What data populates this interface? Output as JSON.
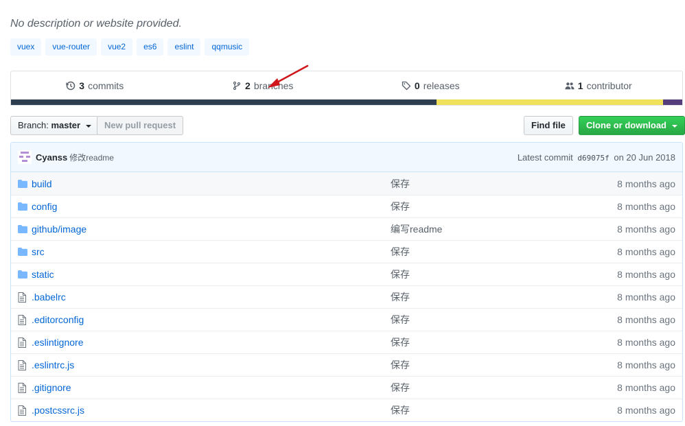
{
  "repo": {
    "description": "No description or website provided.",
    "topics": [
      "vuex",
      "vue-router",
      "vue2",
      "es6",
      "eslint",
      "qqmusic"
    ]
  },
  "summary": {
    "commits": {
      "count": "3",
      "label": "commits"
    },
    "branches": {
      "count": "2",
      "label": "branches"
    },
    "releases": {
      "count": "0",
      "label": "releases"
    },
    "contributors": {
      "count": "1",
      "label": "contributor"
    }
  },
  "language_bar": [
    {
      "color": "#2c3e50",
      "fraction": 0.634
    },
    {
      "color": "#f1e05a",
      "fraction": 0.337
    },
    {
      "color": "#563d7c",
      "fraction": 0.029
    }
  ],
  "toolbar": {
    "branch_prefix": "Branch:",
    "branch_name": "master",
    "new_pr_label": "New pull request",
    "find_file_label": "Find file",
    "clone_label": "Clone or download"
  },
  "latest_commit": {
    "author": "Cyanss",
    "message": "修改readme",
    "prefix": "Latest commit",
    "sha": "d69075f",
    "date": "on 20 Jun 2018"
  },
  "files": [
    {
      "type": "dir",
      "name": "build",
      "message": "保存",
      "age": "8 months ago"
    },
    {
      "type": "dir",
      "name": "config",
      "message": "保存",
      "age": "8 months ago"
    },
    {
      "type": "dir",
      "name": "github/image",
      "message": "编写readme",
      "age": "8 months ago"
    },
    {
      "type": "dir",
      "name": "src",
      "message": "保存",
      "age": "8 months ago"
    },
    {
      "type": "dir",
      "name": "static",
      "message": "保存",
      "age": "8 months ago"
    },
    {
      "type": "file",
      "name": ".babelrc",
      "message": "保存",
      "age": "8 months ago"
    },
    {
      "type": "file",
      "name": ".editorconfig",
      "message": "保存",
      "age": "8 months ago"
    },
    {
      "type": "file",
      "name": ".eslintignore",
      "message": "保存",
      "age": "8 months ago"
    },
    {
      "type": "file",
      "name": ".eslintrc.js",
      "message": "保存",
      "age": "8 months ago"
    },
    {
      "type": "file",
      "name": ".gitignore",
      "message": "保存",
      "age": "8 months ago"
    },
    {
      "type": "file",
      "name": ".postcssrc.js",
      "message": "保存",
      "age": "8 months ago"
    }
  ],
  "annotation": {
    "arrow_color": "#d0161b"
  }
}
